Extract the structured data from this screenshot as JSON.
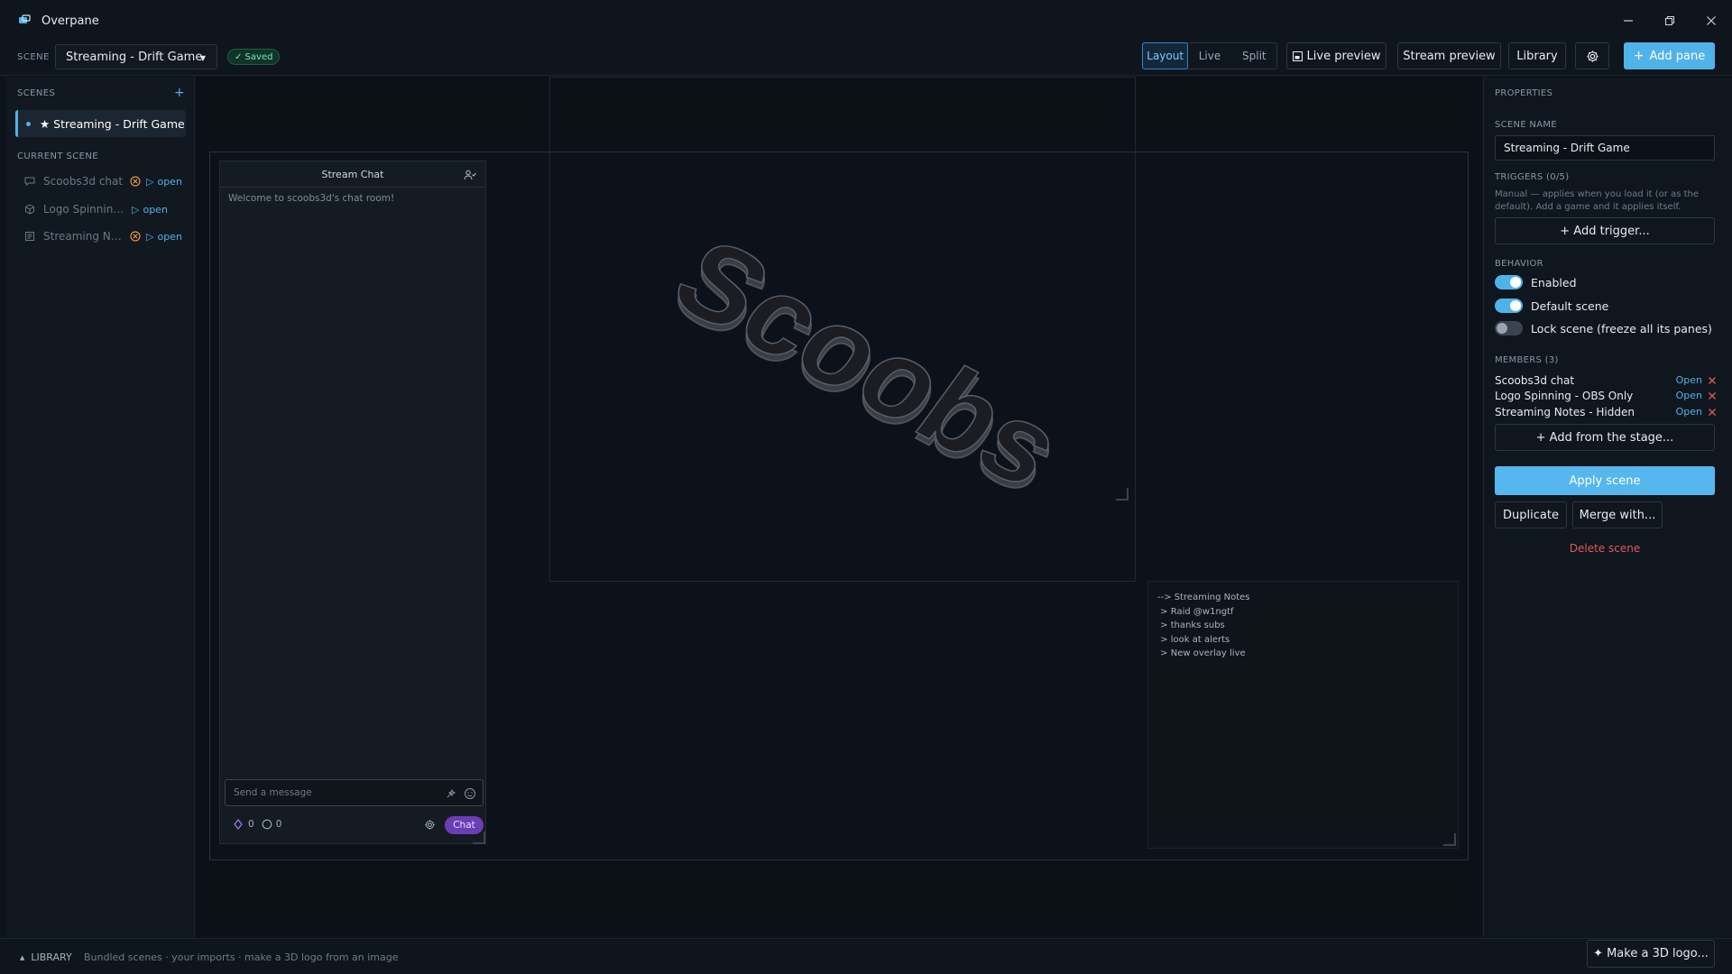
{
  "app": {
    "title": "Overpane"
  },
  "toolbar": {
    "scene_label": "SCENE",
    "scene_value": "Streaming - Drift Game",
    "saved_badge": "✓ Saved",
    "modes": [
      {
        "label": "Layout",
        "active": true
      },
      {
        "label": "Live",
        "active": false
      },
      {
        "label": "Split",
        "active": false
      }
    ],
    "live_preview": "Live preview",
    "stream_preview": "Stream preview",
    "library": "Library",
    "add_pane": "Add pane"
  },
  "sidebar": {
    "scenes_label": "SCENES",
    "add_icon": "plus-icon",
    "active_scene": "★ Streaming - Drift Game",
    "current_label": "CURRENT SCENE",
    "members": [
      {
        "label": "Scoobs3d chat",
        "icon": "chat-icon",
        "warning": true,
        "open": "open"
      },
      {
        "label": "Logo Spinning - OBS Only",
        "icon": "cube-icon",
        "warning": false,
        "open": "open"
      },
      {
        "label": "Streaming Notes - Hidden",
        "icon": "notes-icon",
        "warning": true,
        "open": "open"
      }
    ]
  },
  "stage": {
    "chat": {
      "title": "Stream Chat",
      "welcome": "Welcome to scoobs3d's chat room!",
      "input_placeholder": "Send a message",
      "count_a": "0",
      "count_b": "0",
      "chat_button": "Chat"
    },
    "logo_text": "Scoobs",
    "notes": {
      "lines": [
        "--> Streaming Notes",
        " > Raid @w1ngtf",
        " > thanks subs",
        " > look at alerts",
        " > New overlay live"
      ]
    }
  },
  "properties": {
    "header": "PROPERTIES",
    "scene_name_label": "SCENE NAME",
    "scene_name_value": "Streaming - Drift Game",
    "triggers_label": "TRIGGERS (0/5)",
    "triggers_help": "Manual — applies when you load it (or as the default). Add a game and it applies itself.",
    "add_trigger": "+ Add trigger...",
    "behavior_label": "BEHAVIOR",
    "toggles": [
      {
        "label": "Enabled",
        "on": true
      },
      {
        "label": "Default scene",
        "on": true
      },
      {
        "label": "Lock scene (freeze all its panes)",
        "on": false
      }
    ],
    "members_label": "MEMBERS (3)",
    "members": [
      {
        "label": "Scoobs3d chat",
        "open": "Open"
      },
      {
        "label": "Logo Spinning - OBS Only",
        "open": "Open"
      },
      {
        "label": "Streaming Notes - Hidden",
        "open": "Open"
      }
    ],
    "add_from_stage": "+ Add from the stage...",
    "apply_scene": "Apply scene",
    "duplicate": "Duplicate",
    "merge_with": "Merge with...",
    "delete_scene": "Delete scene"
  },
  "bottombar": {
    "library_label": "LIBRARY",
    "library_desc": "Bundled scenes · your imports · make a 3D logo from an image",
    "make_logo": "✦ Make a 3D logo..."
  },
  "colors": {
    "accent": "#4fb3ea",
    "background": "#0d131b",
    "warning": "#e0943a",
    "danger": "#e05a5a",
    "chat_button": "#6a3fb5"
  }
}
